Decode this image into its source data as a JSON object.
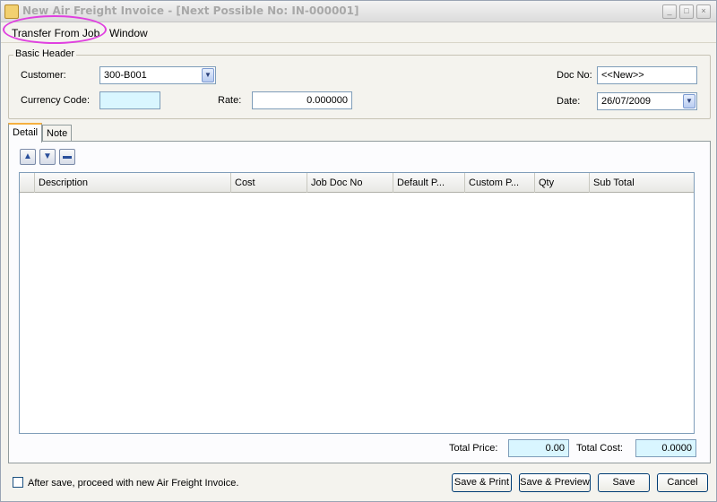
{
  "window": {
    "title": "New Air Freight Invoice  - [Next Possible No: IN-000001]",
    "minimize": "_",
    "maximize": "□",
    "close": "×"
  },
  "menu": {
    "items": [
      {
        "label": "Transfer From Job"
      },
      {
        "label": "Window"
      }
    ]
  },
  "header": {
    "group_label": "Basic Header",
    "customer_label": "Customer:",
    "customer_value": "300-B001",
    "currency_label": "Currency Code:",
    "currency_value": "",
    "rate_label": "Rate:",
    "rate_value": "0.000000",
    "docno_label": "Doc No:",
    "docno_value": "<<New>>",
    "date_label": "Date:",
    "date_value": "26/07/2009"
  },
  "tabs": [
    {
      "label": "Detail",
      "active": true
    },
    {
      "label": "Note",
      "active": false
    }
  ],
  "toolbar": {
    "move_up_icon": "arrow-up-icon",
    "move_down_icon": "arrow-down-icon",
    "remove_icon": "minus-icon"
  },
  "grid": {
    "columns": [
      "",
      "Description",
      "Cost",
      "Job Doc No",
      "Default P...",
      "Custom P...",
      "Qty",
      "Sub Total"
    ],
    "rows": []
  },
  "totals": {
    "total_price_label": "Total Price:",
    "total_price_value": "0.00",
    "total_cost_label": "Total Cost:",
    "total_cost_value": "0.0000"
  },
  "footer": {
    "checkbox_label": "After save, proceed with new Air Freight Invoice.",
    "checkbox_checked": false,
    "save_print": "Save & Print",
    "save_preview": "Save & Preview",
    "save": "Save",
    "cancel": "Cancel"
  },
  "colors": {
    "highlight_ring": "#e040e0",
    "input_cyan": "#d9f6ff",
    "active_tab_accent": "#f5b040"
  }
}
